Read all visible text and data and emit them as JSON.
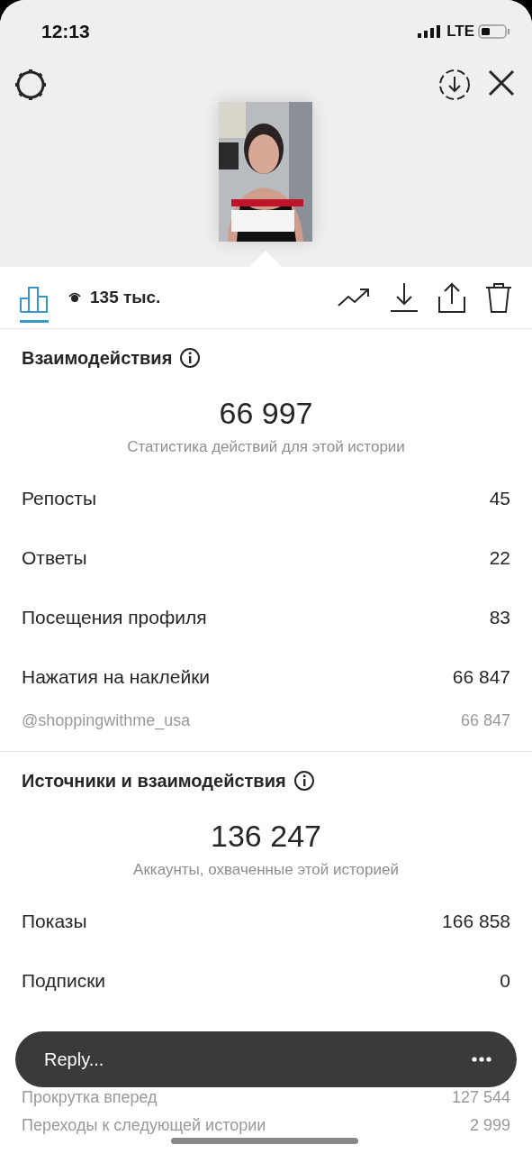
{
  "status_bar": {
    "time": "12:13",
    "network": "LTE"
  },
  "views": {
    "count": "135 тыс.",
    "stats_tab_selected": true
  },
  "sections": [
    {
      "title": "Взаимодействия",
      "total": "66 997",
      "subtitle": "Статистика действий для этой истории",
      "rows": [
        {
          "kind": "main",
          "label": "Репосты",
          "value": "45"
        },
        {
          "kind": "main",
          "label": "Ответы",
          "value": "22"
        },
        {
          "kind": "main",
          "label": "Посещения профиля",
          "value": "83"
        },
        {
          "kind": "main",
          "label": "Нажатия на наклейки",
          "value": "66 847"
        },
        {
          "kind": "sub",
          "label": "@shoppingwithme_usa",
          "value": "66 847"
        }
      ]
    },
    {
      "title": "Источники и взаимодействия",
      "total": "136 247",
      "subtitle": "Аккаунты, охваченные этой историей",
      "rows": [
        {
          "kind": "main",
          "label": "Показы",
          "value": "166 858"
        },
        {
          "kind": "main",
          "label": "Подписки",
          "value": "0"
        },
        {
          "kind": "sub",
          "label": "Прокрутка вперед",
          "value": "127 544"
        },
        {
          "kind": "sub",
          "label": "Переходы к следующей истории",
          "value": "2 999"
        }
      ]
    }
  ],
  "reply_bar": {
    "placeholder": "Reply..."
  }
}
